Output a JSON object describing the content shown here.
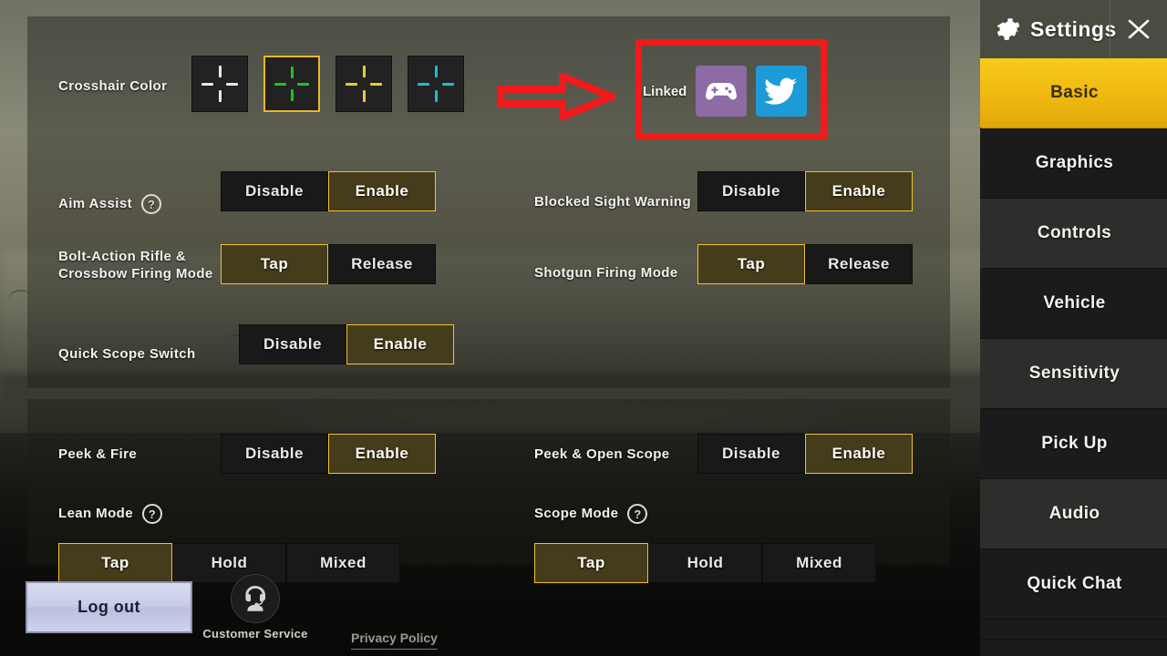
{
  "header": {
    "title": "Settings",
    "gear_icon": "gear-icon",
    "close_icon": "close-icon"
  },
  "sidebar": {
    "items": [
      {
        "label": "Basic",
        "active": true
      },
      {
        "label": "Graphics",
        "active": false
      },
      {
        "label": "Controls",
        "active": false
      },
      {
        "label": "Vehicle",
        "active": false
      },
      {
        "label": "Sensitivity",
        "active": false
      },
      {
        "label": "Pick Up",
        "active": false
      },
      {
        "label": "Audio",
        "active": false
      },
      {
        "label": "Quick Chat",
        "active": false
      }
    ]
  },
  "crosshair": {
    "label": "Crosshair Color",
    "swatches": [
      {
        "name": "crosshair-white",
        "color": "#e8e8e8",
        "selected": false
      },
      {
        "name": "crosshair-green",
        "color": "#1fc221",
        "selected": true
      },
      {
        "name": "crosshair-yellow",
        "color": "#e5d02a",
        "selected": false
      },
      {
        "name": "crosshair-cyan",
        "color": "#1fbccd",
        "selected": false
      }
    ]
  },
  "linked": {
    "label": "Linked",
    "accounts": [
      {
        "name": "gamepad-account-icon",
        "icon": "gamepad-icon",
        "color": "#8d6ba4"
      },
      {
        "name": "twitter-account-icon",
        "icon": "twitter-icon",
        "color": "#1d9bd7"
      }
    ]
  },
  "annotation": {
    "box_color": "#f21a1a",
    "arrow_color": "#f21a1a"
  },
  "rows_top_left": [
    {
      "label": "Aim Assist",
      "has_help": true,
      "options": [
        {
          "label": "Disable",
          "selected": false
        },
        {
          "label": "Enable",
          "selected": true
        }
      ]
    },
    {
      "label": "Bolt-Action Rifle &\nCrossbow Firing Mode",
      "has_help": false,
      "options": [
        {
          "label": "Tap",
          "selected": true
        },
        {
          "label": "Release",
          "selected": false
        }
      ]
    },
    {
      "label": "Quick Scope Switch",
      "has_help": false,
      "options": [
        {
          "label": "Disable",
          "selected": false
        },
        {
          "label": "Enable",
          "selected": true
        }
      ]
    }
  ],
  "rows_top_right": [
    {
      "label": "Blocked Sight Warning",
      "has_help": false,
      "options": [
        {
          "label": "Disable",
          "selected": false
        },
        {
          "label": "Enable",
          "selected": true
        }
      ]
    },
    {
      "label": "Shotgun Firing Mode",
      "has_help": false,
      "options": [
        {
          "label": "Tap",
          "selected": true
        },
        {
          "label": "Release",
          "selected": false
        }
      ]
    }
  ],
  "rows_bottom_left": [
    {
      "label": "Peek & Fire",
      "has_help": false,
      "options": [
        {
          "label": "Disable",
          "selected": false
        },
        {
          "label": "Enable",
          "selected": true
        }
      ]
    },
    {
      "label": "Lean Mode",
      "has_help": true,
      "options": [
        {
          "label": "Tap",
          "selected": true
        },
        {
          "label": "Hold",
          "selected": false
        },
        {
          "label": "Mixed",
          "selected": false
        }
      ]
    }
  ],
  "rows_bottom_right": [
    {
      "label": "Peek & Open Scope",
      "has_help": false,
      "options": [
        {
          "label": "Disable",
          "selected": false
        },
        {
          "label": "Enable",
          "selected": true
        }
      ]
    },
    {
      "label": "Scope Mode",
      "has_help": true,
      "options": [
        {
          "label": "Tap",
          "selected": true
        },
        {
          "label": "Hold",
          "selected": false
        },
        {
          "label": "Mixed",
          "selected": false
        }
      ]
    }
  ],
  "bottom_bar": {
    "logout_label": "Log out",
    "customer_service_label": "Customer Service",
    "customer_service_icon": "headset-support-icon",
    "privacy_policy_label": "Privacy Policy"
  }
}
